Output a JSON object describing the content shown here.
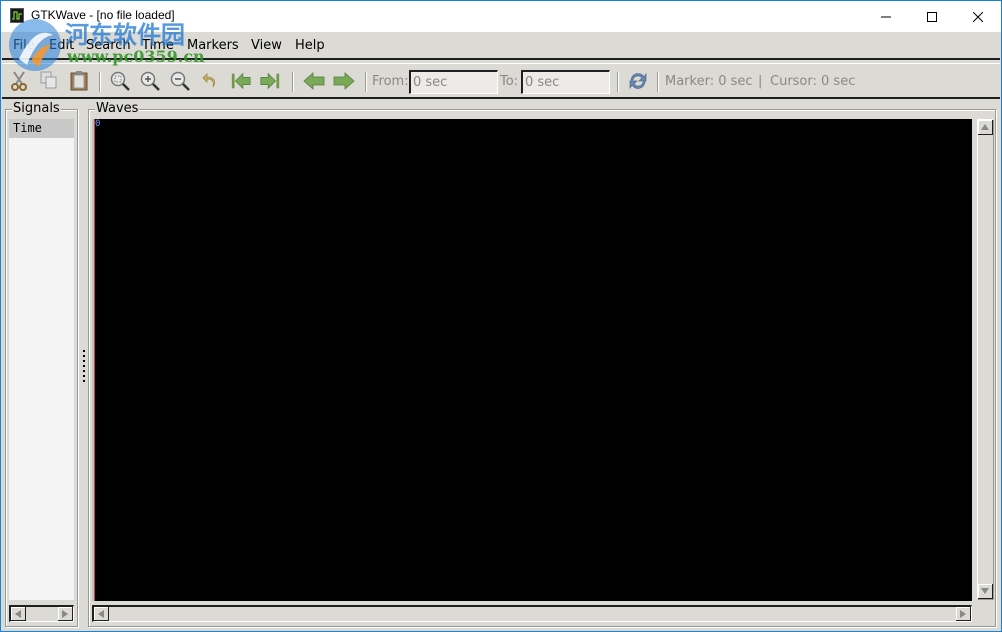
{
  "window": {
    "title": "GTKWave - [no file loaded]",
    "controls": {
      "minimize": "—",
      "maximize": "☐",
      "close": "✕"
    }
  },
  "menubar": {
    "items": [
      {
        "label": "File"
      },
      {
        "label": "Edit"
      },
      {
        "label": "Search"
      },
      {
        "label": "Time"
      },
      {
        "label": "Markers"
      },
      {
        "label": "View"
      },
      {
        "label": "Help"
      }
    ]
  },
  "toolbar": {
    "icons": [
      {
        "name": "cut-icon"
      },
      {
        "name": "copy-icon"
      },
      {
        "name": "paste-icon"
      },
      {
        "name": "zoom-fit-icon"
      },
      {
        "name": "zoom-in-icon"
      },
      {
        "name": "zoom-out-icon"
      },
      {
        "name": "undo-zoom-icon"
      },
      {
        "name": "zoom-to-start-icon"
      },
      {
        "name": "zoom-to-end-icon"
      },
      {
        "name": "previous-edge-icon"
      },
      {
        "name": "next-edge-icon"
      },
      {
        "name": "reload-icon"
      }
    ],
    "from_label": "From:",
    "from_value": "0 sec",
    "to_label": "To:",
    "to_value": "0 sec",
    "marker_text": "Marker: 0 sec",
    "divider": "|",
    "cursor_text": "Cursor: 0 sec"
  },
  "signals_pane": {
    "title": "Signals",
    "items": [
      {
        "label": "Time"
      }
    ]
  },
  "waves_pane": {
    "title": "Waves",
    "time_marker_label": "0",
    "background_color": "#000000"
  },
  "watermark": {
    "site_name": "河东软件园",
    "url": "www.pc0359.cn"
  },
  "colors": {
    "window_border": "#1883d7",
    "chrome_bg": "#dcdad5",
    "marker_line": "#d04040"
  }
}
